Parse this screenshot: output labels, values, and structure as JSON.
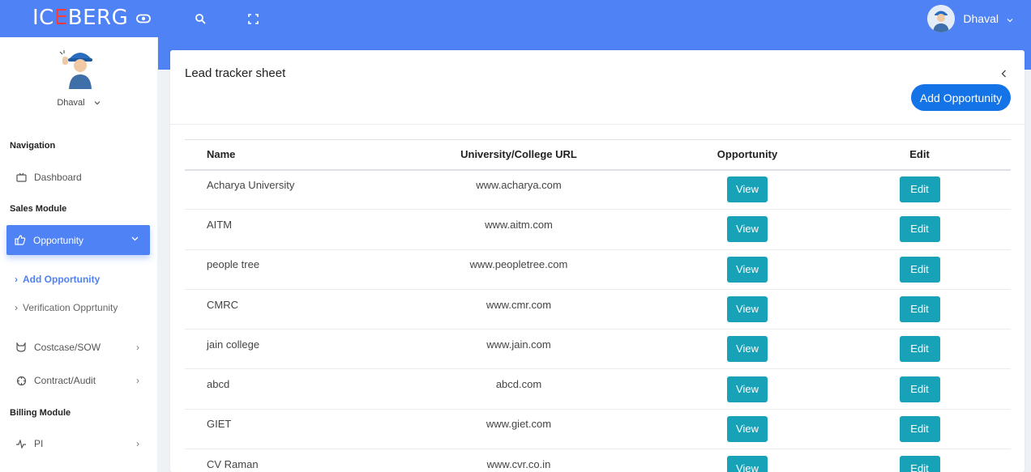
{
  "header": {
    "logo_prefix": "IC",
    "logo_accent": "E",
    "logo_suffix": "BERG",
    "user_name": "Dhaval",
    "icons": [
      "eye-icon",
      "search-icon",
      "fullscreen-icon",
      "chevron-down-icon"
    ]
  },
  "sidebar": {
    "user_name": "Dhaval",
    "sections": {
      "navigation": "Navigation",
      "sales": "Sales Module",
      "billing": "Billing Module"
    },
    "items": {
      "dashboard": "Dashboard",
      "opportunity": "Opportunity",
      "add_opportunity": "Add Opportunity",
      "verification": "Verification Opprtunity",
      "costcase": "Costcase/SOW",
      "contract": "Contract/Audit",
      "pi": "PI"
    }
  },
  "main": {
    "title": "Lead tracker sheet",
    "add_button": "Add Opportunity",
    "table": {
      "headers": [
        "Name",
        "University/College URL",
        "Opportunity",
        "Edit"
      ],
      "view_label": "View",
      "edit_label": "Edit",
      "rows": [
        {
          "name": "Acharya University",
          "url": "www.acharya.com"
        },
        {
          "name": "AITM",
          "url": "www.aitm.com"
        },
        {
          "name": "people tree",
          "url": "www.peopletree.com"
        },
        {
          "name": "CMRC",
          "url": "www.cmr.com"
        },
        {
          "name": "jain college",
          "url": "www.jain.com"
        },
        {
          "name": "abcd",
          "url": "abcd.com"
        },
        {
          "name": "GIET",
          "url": "www.giet.com"
        },
        {
          "name": "CV Raman",
          "url": "www.cvr.co.in"
        }
      ]
    }
  },
  "colors": {
    "header_blue": "#4e82f5",
    "primary_button": "#1473e6",
    "table_button": "#17a2b8",
    "logo_accent": "#ff3b3b"
  }
}
